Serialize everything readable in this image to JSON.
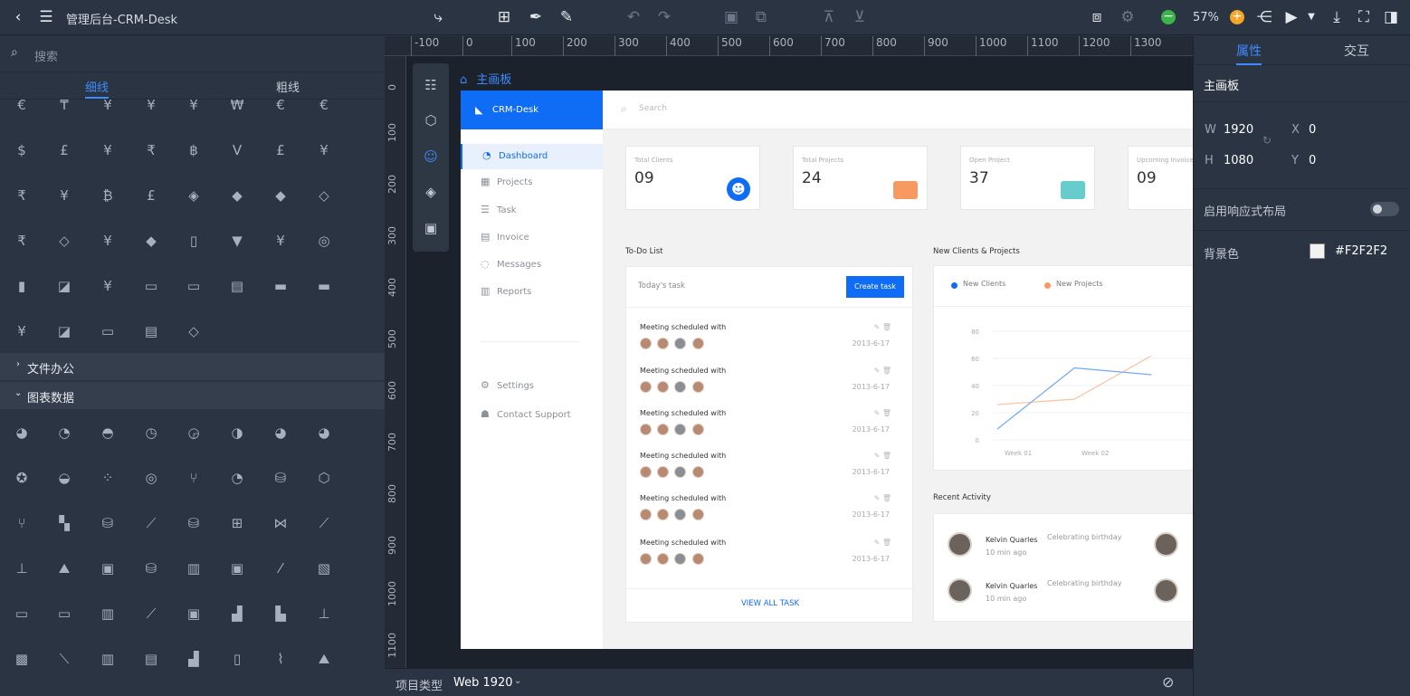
{
  "app": {
    "title": "管理后台-CRM-Desk",
    "zoom": "57%"
  },
  "left": {
    "search_placeholder": "搜索",
    "tabs": [
      "细线",
      "粗线"
    ],
    "categories": [
      {
        "label": "文件办公",
        "expanded": false
      },
      {
        "label": "图表数据",
        "expanded": true
      }
    ]
  },
  "ruler": {
    "top": [
      "-100",
      "0",
      "100",
      "200",
      "300",
      "400",
      "500",
      "600",
      "700",
      "800",
      "900",
      "1000",
      "1100",
      "1200",
      "1300"
    ],
    "left": [
      "0",
      "100",
      "200",
      "300",
      "400",
      "500",
      "600",
      "700",
      "800",
      "900",
      "1000",
      "1100"
    ]
  },
  "board": {
    "label": "主画板",
    "brand": "CRM-Desk",
    "search_placeholder": "Search",
    "nav": [
      {
        "label": "Dashboard",
        "icon": "◔",
        "active": true
      },
      {
        "label": "Projects",
        "icon": "▦"
      },
      {
        "label": "Task",
        "icon": "☰"
      },
      {
        "label": "Invoice",
        "icon": "▤"
      },
      {
        "label": "Messages",
        "icon": "◌"
      },
      {
        "label": "Reports",
        "icon": "▥"
      }
    ],
    "nav_bottom": [
      {
        "label": "Settings",
        "icon": "⚙"
      },
      {
        "label": "Contact Support",
        "icon": "☗"
      }
    ],
    "stats": [
      {
        "label": "Total Clients",
        "value": "09",
        "icon": "person-circle-icon",
        "color": "#0f6cf5"
      },
      {
        "label": "Total Projects",
        "value": "24",
        "icon": "folder-icon",
        "color": "#f79a62"
      },
      {
        "label": "Open Project",
        "value": "37",
        "icon": "folder-icon",
        "color": "#66cccc"
      },
      {
        "label": "Upcoming Invoice",
        "value": "09"
      }
    ],
    "todo": {
      "title": "To-Do List",
      "subtitle": "Today's task",
      "create_label": "Create task",
      "view_all": "VIEW ALL TASK",
      "tasks": [
        {
          "title": "Meeting scheduled with",
          "date": "2013-6-17"
        },
        {
          "title": "Meeting scheduled with",
          "date": "2013-6-17"
        },
        {
          "title": "Meeting scheduled with",
          "date": "2013-6-17"
        },
        {
          "title": "Meeting scheduled with",
          "date": "2013-6-17"
        },
        {
          "title": "Meeting scheduled with",
          "date": "2013-6-17"
        },
        {
          "title": "Meeting scheduled with",
          "date": "2013-6-17"
        }
      ]
    },
    "chart_panel": {
      "title": "New Clients & Projects"
    },
    "activity": {
      "title": "Recent Activity",
      "items": [
        {
          "name": "Kelvin Quarles",
          "time": "10 min ago",
          "event": "Celebrating birthday"
        },
        {
          "name": "Kelvin Quarles",
          "time": "10 min ago",
          "event": "Celebrating birthday"
        }
      ]
    }
  },
  "chart_data": {
    "type": "line",
    "categories": [
      "Week 01",
      "Week 02"
    ],
    "ylim": [
      0,
      80
    ],
    "yticks": [
      "80",
      "60",
      "40",
      "20",
      "0"
    ],
    "x": [
      0,
      1,
      2,
      3,
      4
    ],
    "series": [
      {
        "name": "New Clients",
        "color": "#0f6cf5",
        "values": [
          8,
          53,
          48
        ]
      },
      {
        "name": "New Projects",
        "color": "#f79a62",
        "values": [
          26,
          30,
          62
        ]
      }
    ],
    "xlim": [
      0,
      3.05
    ],
    "legend": "top-left"
  },
  "right": {
    "tabs": [
      "属性",
      "交互"
    ],
    "section": "主画板",
    "w_label": "W",
    "w": "1920",
    "h_label": "H",
    "h": "1080",
    "x_label": "X",
    "x": "0",
    "y_label": "Y",
    "y": "0",
    "responsive_label": "启用响应式布局",
    "bg_label": "背景色",
    "bg_value": "#F2F2F2"
  },
  "bottom": {
    "project_type_label": "项目类型",
    "project_type": "Web 1920"
  }
}
